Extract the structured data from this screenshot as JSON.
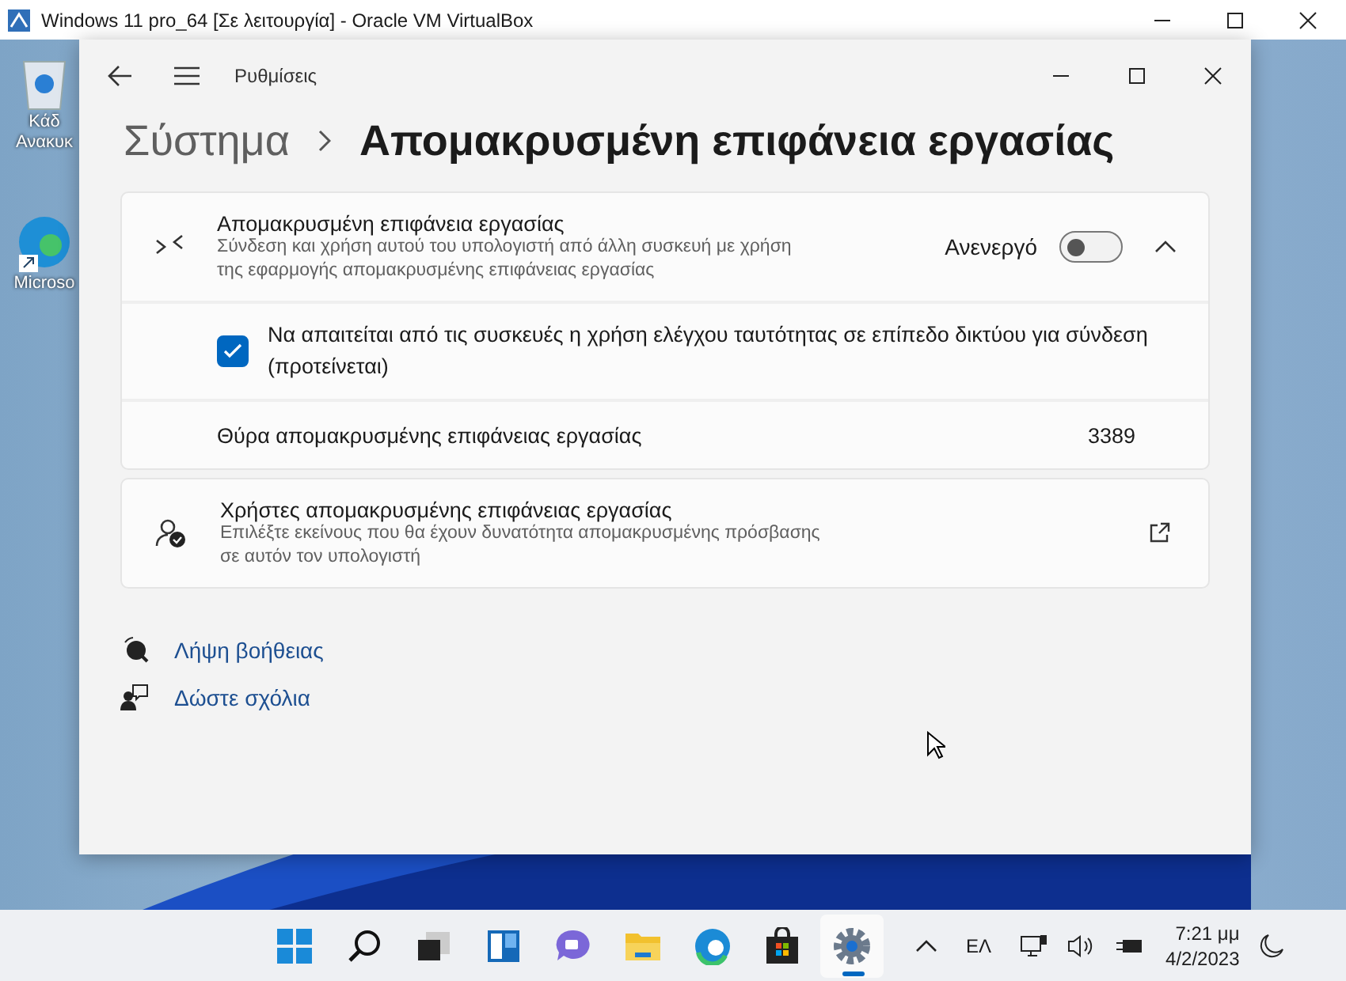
{
  "vbox": {
    "title": "Windows 11 pro_64 [Σε λειτουργία] - Oracle VM VirtualBox"
  },
  "desktop_icons": [
    {
      "kind": "recycle",
      "label_lines": [
        "Κάδ",
        "Ανακυκ"
      ]
    },
    {
      "kind": "edge",
      "label_lines": [
        "Microso"
      ]
    }
  ],
  "settings": {
    "app_title": "Ρυθμίσεις",
    "breadcrumb": {
      "parent": "Σύστημα",
      "current": "Απομακρυσμένη επιφάνεια εργασίας"
    },
    "remote_desktop": {
      "title": "Απομακρυσμένη επιφάνεια εργασίας",
      "description": "Σύνδεση και χρήση αυτού του υπολογιστή από άλλη συσκευή με χρήση της εφαρμογής απομακρυσμένης επιφάνειας εργασίας",
      "toggle_label": "Ανενεργό",
      "on": false,
      "expanded": true,
      "nla": {
        "label": "Να απαιτείται από τις συσκευές η χρήση ελέγχου ταυτότητας σε επίπεδο δικτύου για σύνδεση (προτείνεται)",
        "checked": true
      },
      "port": {
        "label": "Θύρα απομακρυσμένης επιφάνειας εργασίας",
        "value": "3389"
      }
    },
    "users": {
      "title": "Χρήστες απομακρυσμένης επιφάνειας εργασίας",
      "description": "Επιλέξτε εκείνους που θα έχουν δυνατότητα απομακρυσμένης πρόσβασης σε αυτόν τον υπολογιστή"
    },
    "links": [
      {
        "kind": "help",
        "label": "Λήψη βοήθειας"
      },
      {
        "kind": "feedback",
        "label": "Δώστε σχόλια"
      }
    ]
  },
  "taskbar": {
    "apps": [
      {
        "kind": "start",
        "selected": false
      },
      {
        "kind": "search",
        "selected": false
      },
      {
        "kind": "taskview",
        "selected": false
      },
      {
        "kind": "widgets",
        "selected": false
      },
      {
        "kind": "chat",
        "selected": false
      },
      {
        "kind": "explorer",
        "selected": false
      },
      {
        "kind": "edge",
        "selected": false
      },
      {
        "kind": "store",
        "selected": false
      },
      {
        "kind": "settings",
        "selected": true
      }
    ],
    "language": "ΕΛ",
    "time": "7:21 μμ",
    "date": "4/2/2023"
  }
}
